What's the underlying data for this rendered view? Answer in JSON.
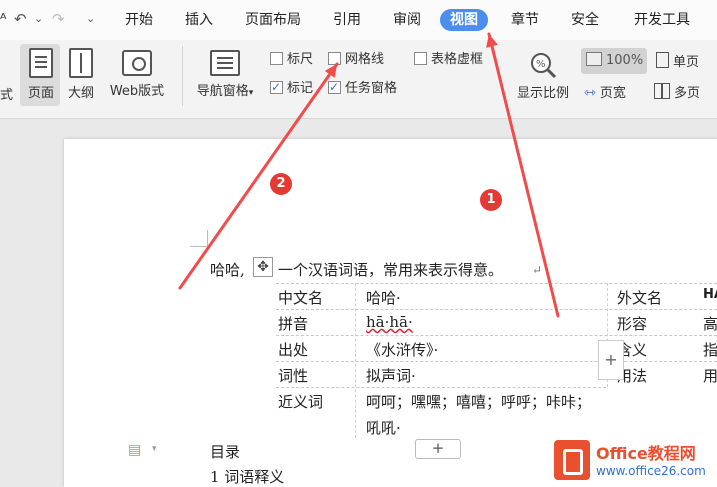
{
  "menu": {
    "undo": "↶",
    "undo_caret": "⌄",
    "redo": "↷",
    "more": "⌄",
    "tabs": [
      "开始",
      "插入",
      "页面布局",
      "引用",
      "审阅",
      "视图",
      "章节",
      "安全",
      "开发工具"
    ],
    "active_tab": "视图"
  },
  "ribbon": {
    "views": {
      "cut_left": "式",
      "page": "页面",
      "outline": "大纲",
      "web": "Web版式"
    },
    "nav_pane": "导航窗格",
    "nav_pane_caret": "▾",
    "checkboxes": {
      "ruler": "标尺",
      "gridlines": "网格线",
      "table_gridlines": "表格虚框",
      "marks": "标记",
      "task_pane": "任务窗格"
    },
    "zoom_label": "显示比例",
    "zoom_value": "100%",
    "page_width": "页宽",
    "single_page": "单页",
    "multi_page": "多页"
  },
  "document": {
    "intro_head": "哈哈,",
    "intro_tail": "一个汉语词语，常用来表示得意。",
    "para_mark": "↵",
    "table": {
      "rows": [
        {
          "label": "中文名",
          "value": "哈哈·"
        },
        {
          "label": "拼音",
          "value": "hā·hā·"
        },
        {
          "label": "出处",
          "value": "《水浒传》·"
        },
        {
          "label": "词性",
          "value": "拟声词·"
        },
        {
          "label": "近义词",
          "value": "呵呵；嘿嘿；嘻嘻；呼呼；咔咔；"
        }
      ],
      "row5_cont": "吼吼·",
      "right_labels": [
        "外文名",
        "形容",
        "含义",
        "用法"
      ],
      "right_values": [
        "HA",
        "高",
        "指",
        "用"
      ]
    },
    "toc_title": "目录",
    "toc_item1": "1 词语释义",
    "add_row_symbol": "+"
  },
  "annotations": {
    "badge1": "1",
    "badge2": "2",
    "arrow_color": "#f24b4b"
  },
  "watermark": {
    "title": "Office教程网",
    "url": "www.office26.com"
  }
}
